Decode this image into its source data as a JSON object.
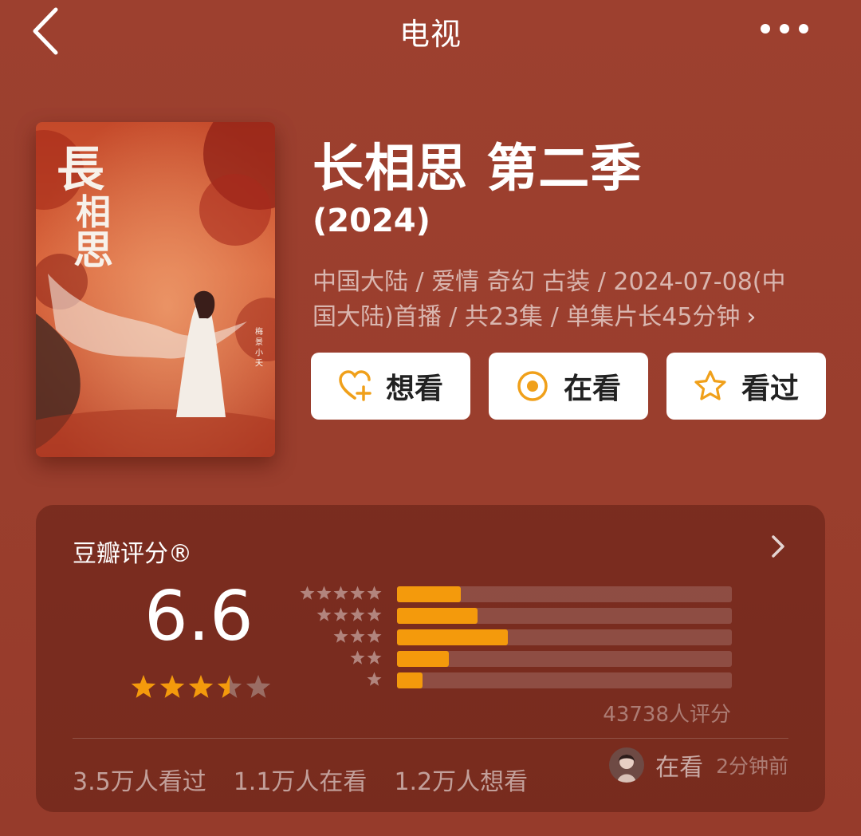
{
  "topbar": {
    "title": "电视",
    "back_icon": "chevron-left-icon",
    "more_icon": "more-horizontal-icon"
  },
  "poster": {
    "calligraphy": "長相思",
    "credit": "梅 景 小 夭"
  },
  "show": {
    "title": "长相思 第二季",
    "year": "(2024)",
    "meta_line1": "中国大陆 / 爱情 奇幻 古装 / 2024-07-08(中",
    "meta_line2": "国大陆)首播 / 共23集 / 单集片长45分钟",
    "meta_chevron": "›"
  },
  "actions": {
    "want": {
      "label": "想看",
      "icon": "heart-plus-icon"
    },
    "watching": {
      "label": "在看",
      "icon": "target-circle-icon"
    },
    "watched": {
      "label": "看过",
      "icon": "star-outline-icon"
    }
  },
  "rating": {
    "label": "豆瓣评分®",
    "score": "6.6",
    "score_value": 6.6,
    "stars_filled": 3.5,
    "stars_total": 5,
    "distribution": [
      {
        "stars": 5,
        "fraction": 0.19
      },
      {
        "stars": 4,
        "fraction": 0.24
      },
      {
        "stars": 3,
        "fraction": 0.33
      },
      {
        "stars": 2,
        "fraction": 0.155
      },
      {
        "stars": 1,
        "fraction": 0.075
      }
    ],
    "count_text": "43738人评分"
  },
  "stats": {
    "watched": "3.5万人看过",
    "watching": "1.1万人在看",
    "want": "1.2万人想看"
  },
  "activity": {
    "status": "在看",
    "time": "2分钟前"
  },
  "colors": {
    "background": "#9c3f2e",
    "accent": "#f49a0c",
    "star_empty": "#9a6d64"
  }
}
